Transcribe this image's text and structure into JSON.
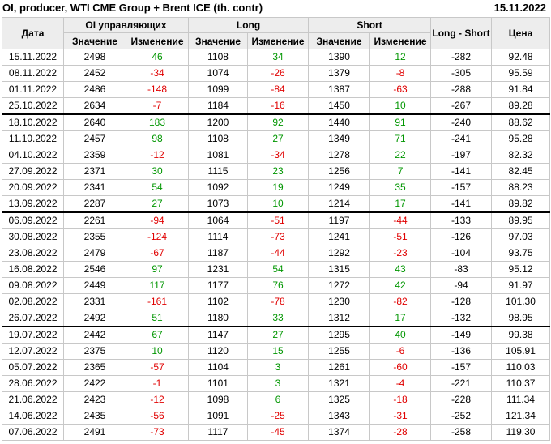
{
  "header": {
    "title": "OI, producer, WTI CME Group + Brent ICE (th. contr)",
    "date": "15.11.2022"
  },
  "columns": {
    "date": "Дата",
    "oi_group": "OI управляющих",
    "long_group": "Long",
    "short_group": "Short",
    "long_short": "Long - Short",
    "price": "Цена",
    "value": "Значение",
    "change": "Изменение"
  },
  "colors": {
    "positive": "#009600",
    "negative": "#e00000",
    "header_bg": "#ededed",
    "separator": "#000000"
  },
  "rows": [
    {
      "date": "15.11.2022",
      "oi": "2498",
      "oi_chg": "46",
      "long": "1108",
      "long_chg": "34",
      "short": "1390",
      "short_chg": "12",
      "ls": "-282",
      "price": "92.48",
      "sep": false
    },
    {
      "date": "08.11.2022",
      "oi": "2452",
      "oi_chg": "-34",
      "long": "1074",
      "long_chg": "-26",
      "short": "1379",
      "short_chg": "-8",
      "ls": "-305",
      "price": "95.59",
      "sep": false
    },
    {
      "date": "01.11.2022",
      "oi": "2486",
      "oi_chg": "-148",
      "long": "1099",
      "long_chg": "-84",
      "short": "1387",
      "short_chg": "-63",
      "ls": "-288",
      "price": "91.84",
      "sep": false
    },
    {
      "date": "25.10.2022",
      "oi": "2634",
      "oi_chg": "-7",
      "long": "1184",
      "long_chg": "-16",
      "short": "1450",
      "short_chg": "10",
      "ls": "-267",
      "price": "89.28",
      "sep": false
    },
    {
      "date": "18.10.2022",
      "oi": "2640",
      "oi_chg": "183",
      "long": "1200",
      "long_chg": "92",
      "short": "1440",
      "short_chg": "91",
      "ls": "-240",
      "price": "88.62",
      "sep": true
    },
    {
      "date": "11.10.2022",
      "oi": "2457",
      "oi_chg": "98",
      "long": "1108",
      "long_chg": "27",
      "short": "1349",
      "short_chg": "71",
      "ls": "-241",
      "price": "95.28",
      "sep": false
    },
    {
      "date": "04.10.2022",
      "oi": "2359",
      "oi_chg": "-12",
      "long": "1081",
      "long_chg": "-34",
      "short": "1278",
      "short_chg": "22",
      "ls": "-197",
      "price": "82.32",
      "sep": false
    },
    {
      "date": "27.09.2022",
      "oi": "2371",
      "oi_chg": "30",
      "long": "1115",
      "long_chg": "23",
      "short": "1256",
      "short_chg": "7",
      "ls": "-141",
      "price": "82.45",
      "sep": false
    },
    {
      "date": "20.09.2022",
      "oi": "2341",
      "oi_chg": "54",
      "long": "1092",
      "long_chg": "19",
      "short": "1249",
      "short_chg": "35",
      "ls": "-157",
      "price": "88.23",
      "sep": false
    },
    {
      "date": "13.09.2022",
      "oi": "2287",
      "oi_chg": "27",
      "long": "1073",
      "long_chg": "10",
      "short": "1214",
      "short_chg": "17",
      "ls": "-141",
      "price": "89.82",
      "sep": false
    },
    {
      "date": "06.09.2022",
      "oi": "2261",
      "oi_chg": "-94",
      "long": "1064",
      "long_chg": "-51",
      "short": "1197",
      "short_chg": "-44",
      "ls": "-133",
      "price": "89.95",
      "sep": true
    },
    {
      "date": "30.08.2022",
      "oi": "2355",
      "oi_chg": "-124",
      "long": "1114",
      "long_chg": "-73",
      "short": "1241",
      "short_chg": "-51",
      "ls": "-126",
      "price": "97.03",
      "sep": false
    },
    {
      "date": "23.08.2022",
      "oi": "2479",
      "oi_chg": "-67",
      "long": "1187",
      "long_chg": "-44",
      "short": "1292",
      "short_chg": "-23",
      "ls": "-104",
      "price": "93.75",
      "sep": false
    },
    {
      "date": "16.08.2022",
      "oi": "2546",
      "oi_chg": "97",
      "long": "1231",
      "long_chg": "54",
      "short": "1315",
      "short_chg": "43",
      "ls": "-83",
      "price": "95.12",
      "sep": false
    },
    {
      "date": "09.08.2022",
      "oi": "2449",
      "oi_chg": "117",
      "long": "1177",
      "long_chg": "76",
      "short": "1272",
      "short_chg": "42",
      "ls": "-94",
      "price": "91.97",
      "sep": false
    },
    {
      "date": "02.08.2022",
      "oi": "2331",
      "oi_chg": "-161",
      "long": "1102",
      "long_chg": "-78",
      "short": "1230",
      "short_chg": "-82",
      "ls": "-128",
      "price": "101.30",
      "sep": false
    },
    {
      "date": "26.07.2022",
      "oi": "2492",
      "oi_chg": "51",
      "long": "1180",
      "long_chg": "33",
      "short": "1312",
      "short_chg": "17",
      "ls": "-132",
      "price": "98.95",
      "sep": false
    },
    {
      "date": "19.07.2022",
      "oi": "2442",
      "oi_chg": "67",
      "long": "1147",
      "long_chg": "27",
      "short": "1295",
      "short_chg": "40",
      "ls": "-149",
      "price": "99.38",
      "sep": true
    },
    {
      "date": "12.07.2022",
      "oi": "2375",
      "oi_chg": "10",
      "long": "1120",
      "long_chg": "15",
      "short": "1255",
      "short_chg": "-6",
      "ls": "-136",
      "price": "105.91",
      "sep": false
    },
    {
      "date": "05.07.2022",
      "oi": "2365",
      "oi_chg": "-57",
      "long": "1104",
      "long_chg": "3",
      "short": "1261",
      "short_chg": "-60",
      "ls": "-157",
      "price": "110.03",
      "sep": false
    },
    {
      "date": "28.06.2022",
      "oi": "2422",
      "oi_chg": "-1",
      "long": "1101",
      "long_chg": "3",
      "short": "1321",
      "short_chg": "-4",
      "ls": "-221",
      "price": "110.37",
      "sep": false
    },
    {
      "date": "21.06.2022",
      "oi": "2423",
      "oi_chg": "-12",
      "long": "1098",
      "long_chg": "6",
      "short": "1325",
      "short_chg": "-18",
      "ls": "-228",
      "price": "111.34",
      "sep": false
    },
    {
      "date": "14.06.2022",
      "oi": "2435",
      "oi_chg": "-56",
      "long": "1091",
      "long_chg": "-25",
      "short": "1343",
      "short_chg": "-31",
      "ls": "-252",
      "price": "121.34",
      "sep": false
    },
    {
      "date": "07.06.2022",
      "oi": "2491",
      "oi_chg": "-73",
      "long": "1117",
      "long_chg": "-45",
      "short": "1374",
      "short_chg": "-28",
      "ls": "-258",
      "price": "119.30",
      "sep": false
    }
  ]
}
